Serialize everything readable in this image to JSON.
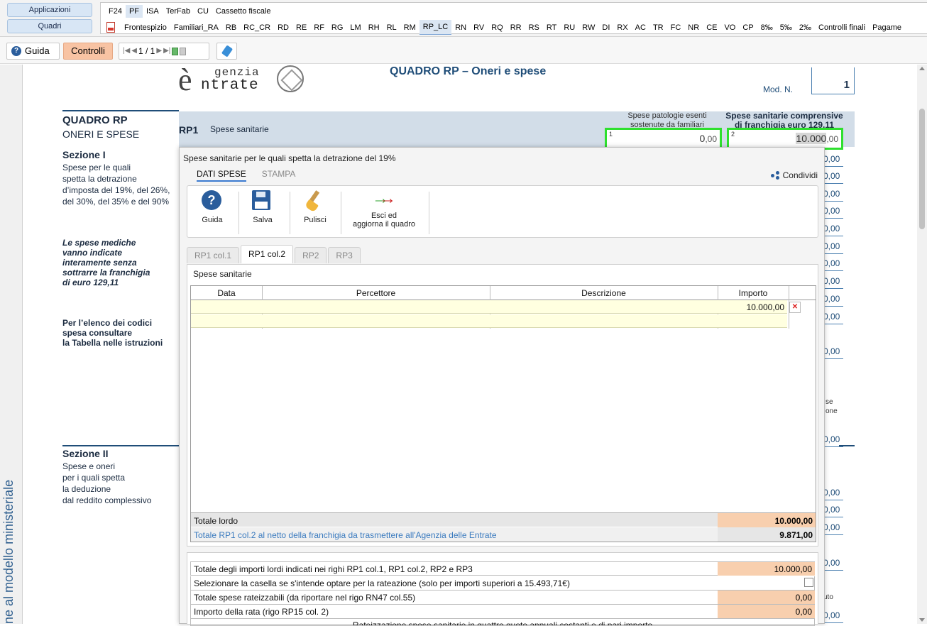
{
  "nav": {
    "left_buttons": [
      "Applicazioni",
      "Quadri"
    ],
    "row1": [
      "F24",
      "PF",
      "ISA",
      "TerFab",
      "CU",
      "Cassetto fiscale"
    ],
    "row1_selected": "PF",
    "row2": [
      "Frontespizio",
      "Familiari_RA",
      "RB",
      "RC_CR",
      "RD",
      "RE",
      "RF",
      "RG",
      "LM",
      "RH",
      "RL",
      "RM",
      "RP_LC",
      "RN",
      "RV",
      "RQ",
      "RR",
      "RS",
      "RT",
      "RU",
      "RW",
      "DI",
      "RX",
      "AC",
      "TR",
      "FC",
      "NR",
      "CE",
      "VO",
      "CP",
      "8‰",
      "5‰",
      "2‰",
      "Controlli finali",
      "Pagame"
    ],
    "row2_selected": "RP_LC"
  },
  "toolbar": {
    "guida": "Guida",
    "controlli": "Controlli",
    "pager": "1 / 1"
  },
  "doc": {
    "logo_line1": "genzia",
    "logo_line2": "ntrate",
    "logo_initial": "è",
    "title": "QUADRO RP – Oneri e spese",
    "mod_label": "Mod. N.",
    "mod_value": "1",
    "left_title": "QUADRO RP",
    "left_sub": "ONERI E SPESE",
    "sez1_title": "Sezione I",
    "sez1_text": [
      "Spese per le quali",
      "spetta la detrazione",
      "d’imposta del 19%, del 26%,",
      "del 30%, del 35% e del 90%"
    ],
    "note_italic": [
      "Le spese mediche",
      "vanno indicate",
      "interamente senza",
      "sottrarre la franchigia",
      "di euro 129,11"
    ],
    "note_bold": [
      "Per l’elenco dei codici",
      "spesa consultare",
      "la Tabella nelle istruzioni"
    ],
    "sez2_title": "Sezione II",
    "sez2_text": [
      "Spese e oneri",
      "per i quali spetta",
      "la deduzione",
      "dal reddito complessivo"
    ],
    "vertical_text": "ne al modello ministeriale",
    "rp1_code": "RP1",
    "rp1_label": "Spese sanitarie",
    "col1_label": "Spese patologie esenti sostenute da familiari",
    "col2_label": "Spese sanitarie comprensive di franchigia euro 129,11",
    "col1_mark": "1",
    "col2_mark": "2",
    "col1_value": "0",
    "col1_dec": ",00",
    "col2_value": "10.000",
    "col2_dec": ",00",
    "right_values": [
      "0,00",
      "0,00",
      "0,00",
      "0,00",
      "0,00",
      "0,00",
      "0,00",
      "0,00",
      "0,00",
      "0,00",
      "0,00",
      "0,00",
      "0,00",
      "0,00",
      "0,00",
      "0,00",
      "0,00"
    ],
    "right_frag1": "se",
    "right_frag2": "one",
    "right_frag3": "uto"
  },
  "modal": {
    "title": "Spese sanitarie per le quali spetta la detrazione del 19%",
    "tab_active": "DATI SPESE",
    "tab_other": "STAMPA",
    "share": "Condividi",
    "actions": {
      "guida": "Guida",
      "salva": "Salva",
      "pulisci": "Pulisci",
      "esci_line1": "Esci ed",
      "esci_line2": "aggiorna il quadro"
    },
    "rtabs": [
      "RP1 col.1",
      "RP1 col.2",
      "RP2",
      "RP3"
    ],
    "rtab_active": "RP1 col.2",
    "section_label": "Spese sanitarie",
    "columns": [
      "Data",
      "Percettore",
      "Descrizione",
      "Importo"
    ],
    "rows": [
      {
        "data": "",
        "percettore": "",
        "descrizione": "",
        "importo": "10.000,00"
      },
      {
        "data": "",
        "percettore": "",
        "descrizione": "",
        "importo": ""
      }
    ],
    "totale_lordo_label": "Totale lordo",
    "totale_lordo_value": "10.000,00",
    "totale_netto_label": "Totale RP1 col.2 al netto della franchigia da trasmettere all'Agenzia delle Entrate",
    "totale_netto_value": "9.871,00",
    "summary": {
      "r1_label": "Totale degli importi lordi indicati nei righi RP1 col.1, RP1 col.2, RP2 e RP3",
      "r1_value": "10.000,00",
      "r2_label": "Selezionare la casella se s'intende optare per la rateazione (solo per importi superiori a 15.493,71€)",
      "r3_label": "Totale spese rateizzabili (da riportare nel rigo RN47 col.55)",
      "r3_value": "0,00",
      "r4_label": "Importo della rata (rigo RP15 col. 2)",
      "r4_value": "0,00",
      "footer": "Rateizzazione spese sanitarie in quattro quote annuali costanti e di pari importo"
    }
  }
}
